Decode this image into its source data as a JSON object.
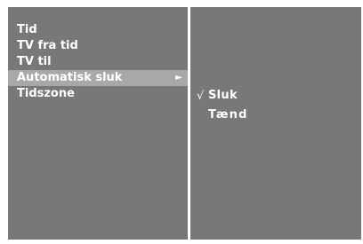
{
  "left_menu": {
    "items": [
      {
        "label": "Tid"
      },
      {
        "label": "TV fra tid"
      },
      {
        "label": "TV til"
      },
      {
        "label": "Automatisk sluk",
        "arrow": "►"
      },
      {
        "label": "Tidszone"
      }
    ],
    "selected_index": 3
  },
  "sub_menu": {
    "options": [
      {
        "label": "Sluk",
        "check": "√",
        "checked": true
      },
      {
        "label": "Tænd",
        "checked": false
      }
    ]
  },
  "colors": {
    "panel": "#787878",
    "highlight": "#a8a8a8",
    "text": "#ffffff",
    "background": "#ffffff"
  },
  "icons": {
    "submenu_arrow": "right-triangle-icon",
    "checkmark": "check-icon"
  }
}
